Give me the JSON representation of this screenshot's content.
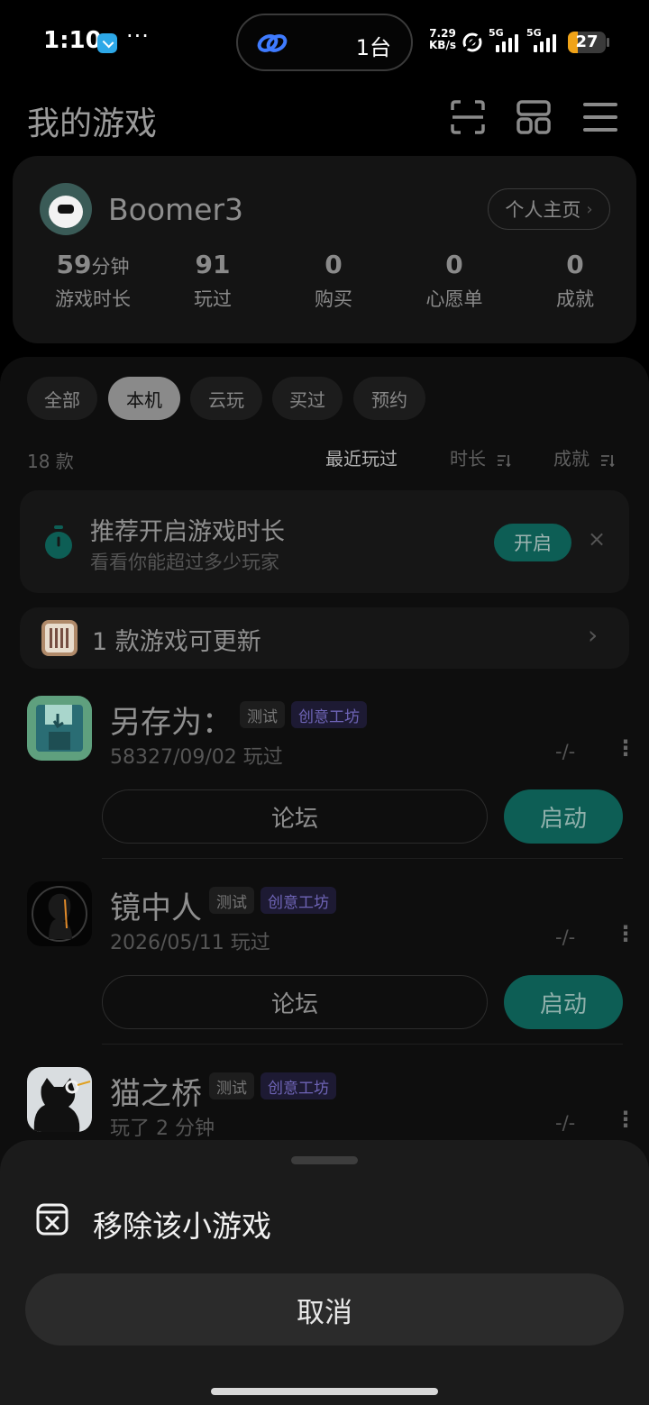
{
  "status_bar": {
    "time": "1:10",
    "more": "···",
    "island_text": "1台",
    "net_speed_value": "7.29",
    "net_speed_unit": "KB/s",
    "sim1_label": "5G",
    "sim2_label": "5G",
    "battery_level": "27",
    "battery_color": "#f0a318"
  },
  "header": {
    "title": "我的游戏",
    "icons": [
      "scan-icon",
      "grid-icon",
      "menu-icon"
    ]
  },
  "profile": {
    "username": "Boomer3",
    "home_button": "个人主页",
    "stats": [
      {
        "value": "59",
        "unit": "分钟",
        "label": "游戏时长"
      },
      {
        "value": "91",
        "unit": "",
        "label": "玩过"
      },
      {
        "value": "0",
        "unit": "",
        "label": "购买"
      },
      {
        "value": "0",
        "unit": "",
        "label": "心愿单"
      },
      {
        "value": "0",
        "unit": "",
        "label": "成就"
      }
    ]
  },
  "filters": {
    "tabs": [
      "全部",
      "本机",
      "云玩",
      "买过",
      "预约"
    ],
    "active": "本机",
    "count": "18 款",
    "sorts": [
      "最近玩过",
      "时长",
      "成就"
    ]
  },
  "tip": {
    "title": "推荐开启游戏时长",
    "subtitle": "看看你能超过多少玩家",
    "button": "开启",
    "close": "×"
  },
  "update": {
    "text": "1 款游戏可更新",
    "chevron": "›"
  },
  "games": [
    {
      "title": "另存为：",
      "tag_test": "测试",
      "tag_creative": "创意工坊",
      "subtitle": "58327/09/02 玩过",
      "score": "-/-",
      "forum": "论坛",
      "launch": "启动"
    },
    {
      "title": "镜中人",
      "tag_test": "测试",
      "tag_creative": "创意工坊",
      "subtitle": "2026/05/11 玩过",
      "score": "-/-",
      "forum": "论坛",
      "launch": "启动"
    },
    {
      "title": "猫之桥",
      "tag_test": "测试",
      "tag_creative": "创意工坊",
      "subtitle": "玩了 2 分钟",
      "score": "-/-"
    }
  ],
  "sheet": {
    "remove_label": "移除该小游戏",
    "cancel_label": "取消"
  },
  "colors": {
    "accent": "#0d5e55",
    "creative_tag": "#6e64b6"
  }
}
